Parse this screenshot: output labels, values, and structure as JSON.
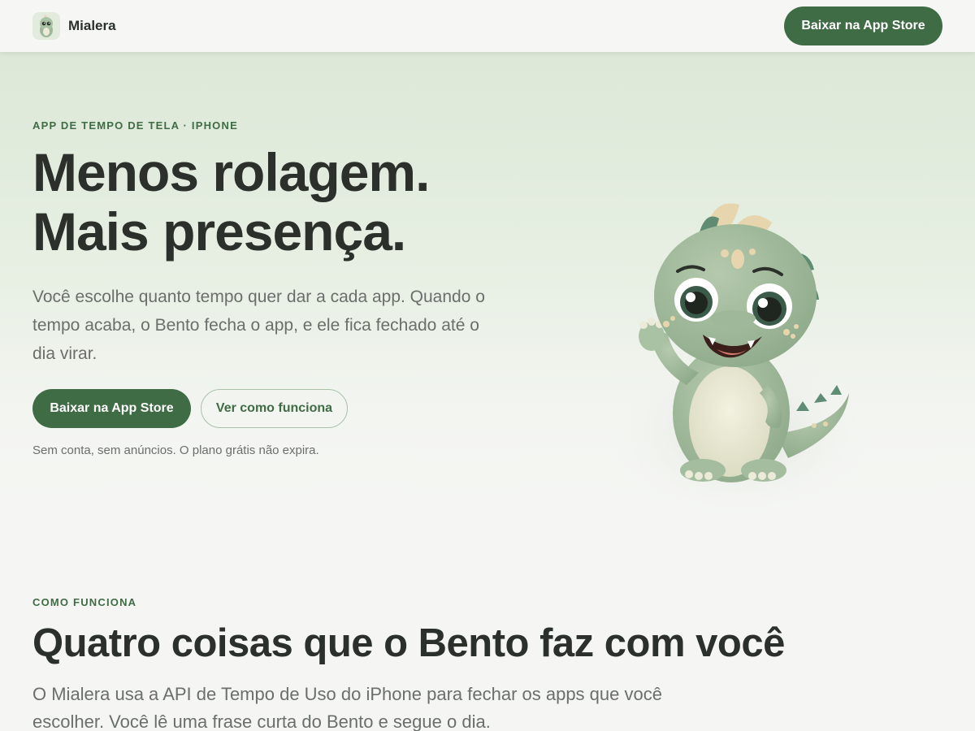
{
  "header": {
    "brand_name": "Mialera",
    "logo_icon": "dino-mascot-icon",
    "cta_label": "Baixar na App Store"
  },
  "hero": {
    "eyebrow": "APP DE TEMPO DE TELA · IPHONE",
    "title_line1": "Menos rolagem.",
    "title_line2": "Mais presença.",
    "description": "Você escolhe quanto tempo quer dar a cada app. Quando o tempo acaba, o Bento fecha o app, e ele fica fechado até o dia virar.",
    "primary_cta": "Baixar na App Store",
    "secondary_cta": "Ver como funciona",
    "note": "Sem conta, sem anúncios. O plano grátis não expira.",
    "mascot_icon": "dino-mascot-illustration"
  },
  "section": {
    "eyebrow": "COMO FUNCIONA",
    "title": "Quatro coisas que o Bento faz com você",
    "description": "O Mialera usa a API de Tempo de Uso do iPhone para fechar os apps que você escolher. Você lê uma frase curta do Bento e segue o dia."
  },
  "colors": {
    "accent": "#3f6b45",
    "text": "#2b302b",
    "muted": "#6b6f6b",
    "hero_bg": "#dde8d8",
    "page_bg": "#f5f6f3"
  }
}
